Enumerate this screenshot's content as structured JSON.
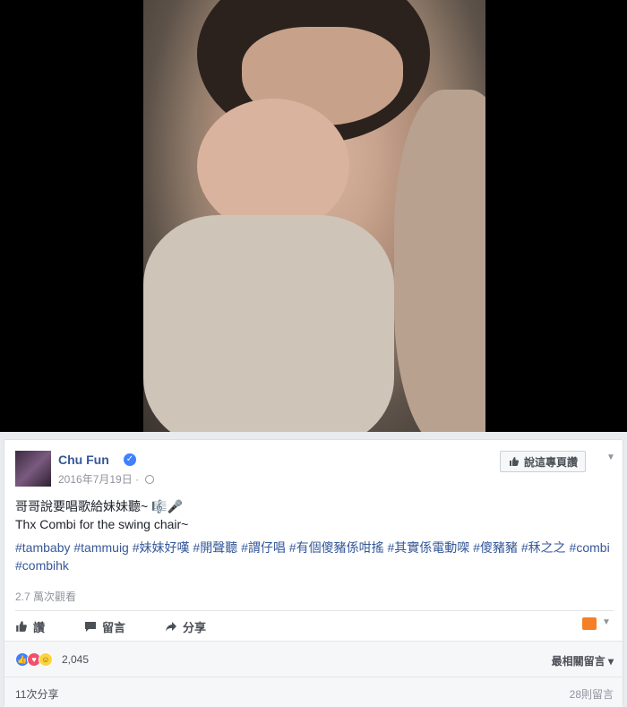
{
  "post": {
    "page_name": "Chu Fun",
    "verified_mark": "✓",
    "date": "2016年7月19日",
    "date_sep": "·",
    "like_page_label": "說這專頁讚",
    "text_line1": "哥哥說要唱歌給妹妹聽~ 🎼🎤",
    "text_line2": "Thx Combi for the swing chair~",
    "hashtags": [
      "#tambaby",
      "#tammuig",
      "#妹妹好嘆",
      "#開聲聽",
      "#謂仔唱",
      "#有個傻豬係咁搖",
      "#其實係電動㗎",
      "#傻豬豬",
      "#秝之之",
      "#combi",
      "#combihk"
    ],
    "views": "2.7 萬次觀看"
  },
  "actions": {
    "like": "讚",
    "comment": "留言",
    "share": "分享"
  },
  "reactions": {
    "count": "2,045",
    "sort_label": "最相關留言 ▾"
  },
  "footer": {
    "shares": "11次分享",
    "comments": "28則留言"
  },
  "colors": {
    "link": "#365899",
    "like_blue": "#4080ff",
    "love_red": "#f25268",
    "haha_yellow": "#fcd440"
  }
}
